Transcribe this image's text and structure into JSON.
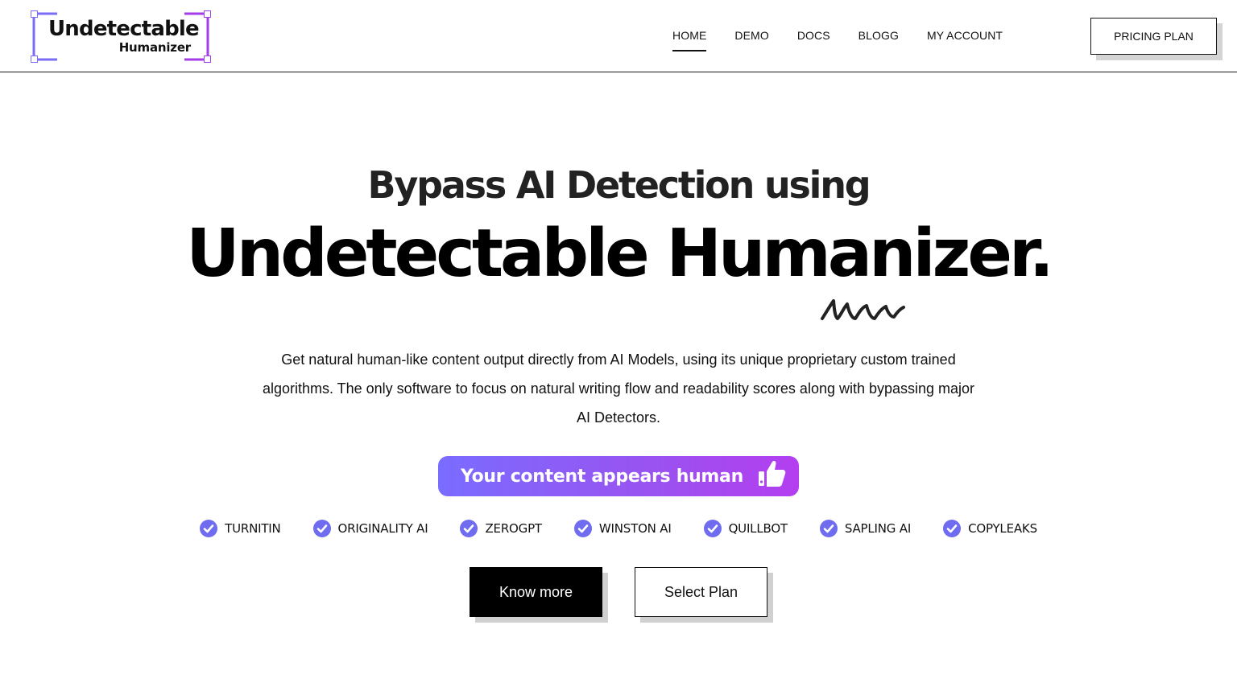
{
  "brand": {
    "line1": "Undetectable",
    "line2": "Humanizer",
    "accent_left": "#7b6cf6",
    "accent_right": "#a43ce8"
  },
  "nav": {
    "items": [
      {
        "label": "HOME",
        "active": true
      },
      {
        "label": "DEMO",
        "active": false
      },
      {
        "label": "DOCS",
        "active": false
      },
      {
        "label": "BLOGG",
        "active": false
      },
      {
        "label": "MY ACCOUNT",
        "active": false
      }
    ],
    "pricing_label": "PRICING PLAN"
  },
  "hero": {
    "subtitle": "Bypass AI Detection using",
    "title": "Undetectable Humanizer.",
    "description": "Get natural human-like content output directly from AI Models, using its unique proprietary custom trained algorithms. The only software to focus on natural writing flow and readability scores along with bypassing major AI Detectors.",
    "badge_text": "Your content appears human",
    "badge_icon": "thumbs-up-icon"
  },
  "detectors": [
    "TURNITIN",
    "ORIGINALITY AI",
    "ZEROGPT",
    "WINSTON AI",
    "QUILLBOT",
    "SAPLING AI",
    "COPYLEAKS"
  ],
  "check_color": "#6f6cf0",
  "cta": {
    "primary_label": "Know more",
    "secondary_label": "Select Plan"
  }
}
